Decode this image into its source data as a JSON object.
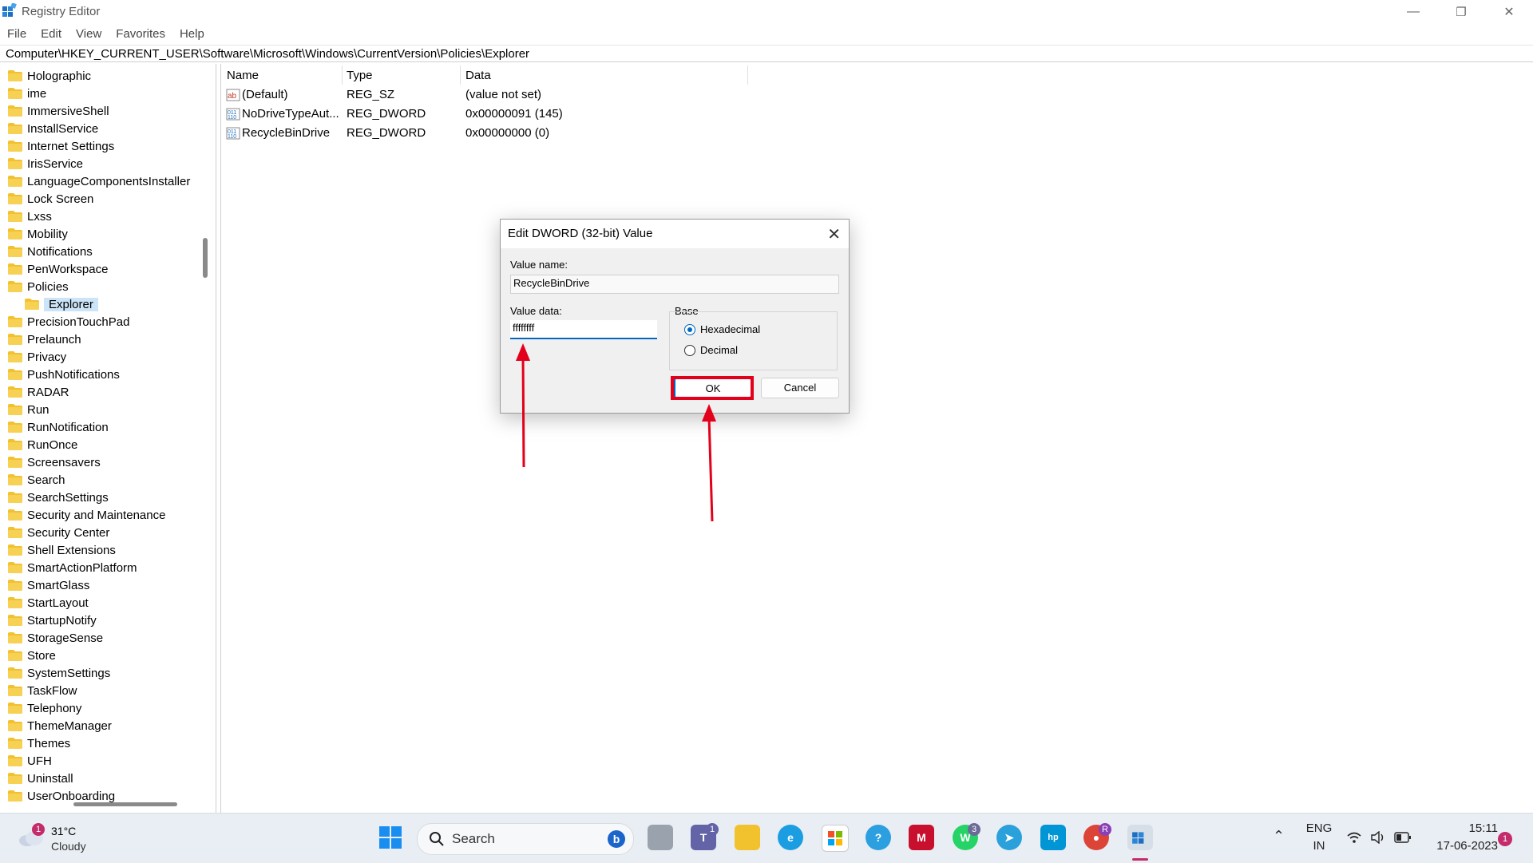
{
  "window": {
    "title": "Registry Editor",
    "minimize": "—",
    "maximize": "❐",
    "close": "✕"
  },
  "menu": [
    "File",
    "Edit",
    "View",
    "Favorites",
    "Help"
  ],
  "address": "Computer\\HKEY_CURRENT_USER\\Software\\Microsoft\\Windows\\CurrentVersion\\Policies\\Explorer",
  "tree": [
    "Holographic",
    "ime",
    "ImmersiveShell",
    "InstallService",
    "Internet Settings",
    "IrisService",
    "LanguageComponentsInstaller",
    "Lock Screen",
    "Lxss",
    "Mobility",
    "Notifications",
    "PenWorkspace",
    "Policies",
    "Explorer",
    "PrecisionTouchPad",
    "Prelaunch",
    "Privacy",
    "PushNotifications",
    "RADAR",
    "Run",
    "RunNotification",
    "RunOnce",
    "Screensavers",
    "Search",
    "SearchSettings",
    "Security and Maintenance",
    "Security Center",
    "Shell Extensions",
    "SmartActionPlatform",
    "SmartGlass",
    "StartLayout",
    "StartupNotify",
    "StorageSense",
    "Store",
    "SystemSettings",
    "TaskFlow",
    "Telephony",
    "ThemeManager",
    "Themes",
    "UFH",
    "Uninstall",
    "UserOnboarding"
  ],
  "columns": {
    "name": "Name",
    "type": "Type",
    "data": "Data"
  },
  "values": [
    {
      "name": "(Default)",
      "type": "REG_SZ",
      "data": "(value not set)",
      "icon": "string-value-icon"
    },
    {
      "name": "NoDriveTypeAut...",
      "type": "REG_DWORD",
      "data": "0x00000091 (145)",
      "icon": "binary-value-icon"
    },
    {
      "name": "RecycleBinDrive",
      "type": "REG_DWORD",
      "data": "0x00000000 (0)",
      "icon": "binary-value-icon"
    }
  ],
  "dialog": {
    "title": "Edit DWORD (32-bit) Value",
    "value_name_label": "Value name:",
    "value_name": "RecycleBinDrive",
    "value_data_label": "Value data:",
    "value_data": "ffffffff",
    "base_label": "Base",
    "hex_label": "Hexadecimal",
    "dec_label": "Decimal",
    "ok_label": "OK",
    "cancel_label": "Cancel"
  },
  "taskbar": {
    "weather_temp": "31°C",
    "weather_desc": "Cloudy",
    "weather_badge": "1",
    "search_label": "Search",
    "teams_badge": "1",
    "whatsapp_badge": "3",
    "chrome_badge": "R",
    "lang_line1": "ENG",
    "lang_line2": "IN",
    "time": "15:11",
    "date": "17-06-2023",
    "notif_count": "1"
  },
  "colors": {
    "accent": "#0067c0",
    "annotation_red": "#e2001a",
    "folder": "#f2c12e"
  }
}
